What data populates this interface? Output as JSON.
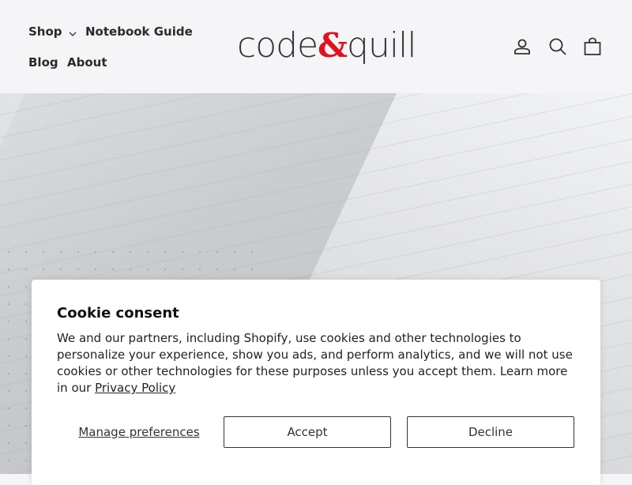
{
  "header": {
    "nav": [
      {
        "label": "Shop"
      },
      {
        "label": "Notebook Guide"
      },
      {
        "label": "Blog"
      },
      {
        "label": "About"
      }
    ],
    "logo": {
      "part1": "code",
      "amp": "&",
      "part2": "quill"
    },
    "icons": [
      "account-icon",
      "search-icon",
      "cart-icon"
    ]
  },
  "cookie": {
    "title": "Cookie consent",
    "body": "We and our partners, including Shopify, use cookies and other technologies to personalize your experience, show you ads, and perform analytics, and we will not use cookies or other technologies for these purposes unless you accept them. Learn more in our ",
    "link": "Privacy Policy",
    "manage_label": "Manage preferences",
    "accept_label": "Accept",
    "decline_label": "Decline"
  },
  "colors": {
    "brand_accent": "#e0121f",
    "header_bg": "#f5f5f7"
  }
}
